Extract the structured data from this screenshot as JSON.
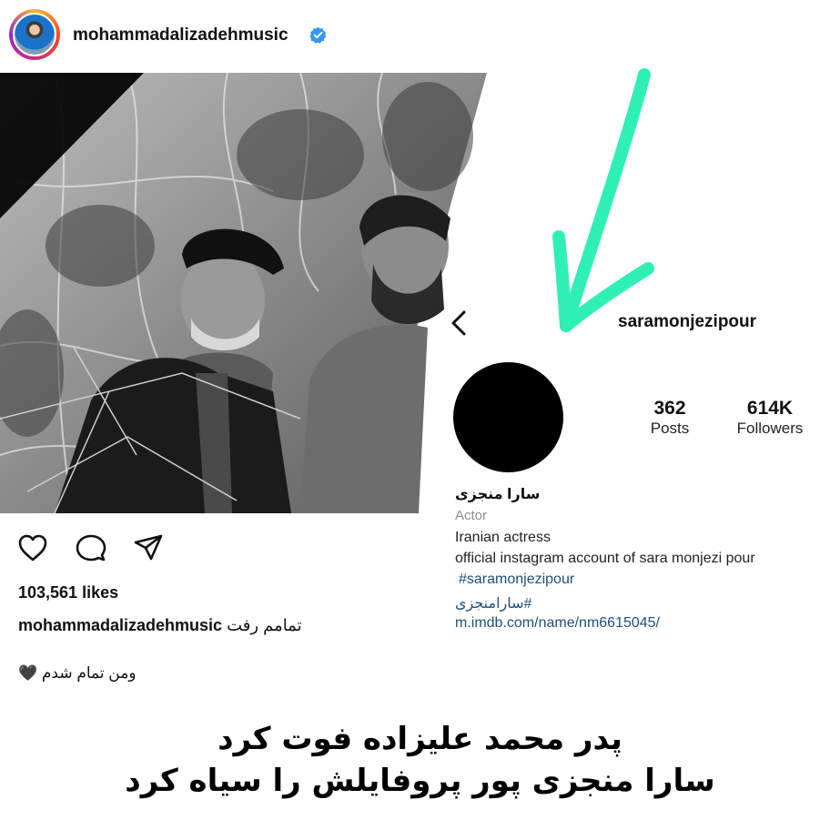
{
  "post": {
    "author_username": "mohammadalizadehmusic",
    "likes": "103,561 likes",
    "caption_text": "تمامم رفت",
    "comment_text": "ومن تمام شدم",
    "comment_emoji": "🖤"
  },
  "profile": {
    "username": "saramonjezipour",
    "stats": [
      {
        "value": "362",
        "label": "Posts"
      },
      {
        "value": "614K",
        "label": "Followers"
      }
    ],
    "display_name": "سارا منجزی",
    "category": "Actor",
    "bio_line1": "Iranian actress",
    "bio_line2": "official instagram account of sara monjezi pour",
    "hashtag_en": "#saramonjezipour",
    "hashtag_fa": "#سارامنجزی",
    "website": "m.imdb.com/name/nm6615045/"
  },
  "headline": {
    "line1": "پدر محمد علیزاده فوت کرد",
    "line2": "سارا منجزی پور پروفایلش را سیاه کرد"
  },
  "icons": {
    "verified": "verified-badge-icon",
    "like": "heart-icon",
    "comment": "comment-bubble-icon",
    "share": "send-paper-plane-icon",
    "back": "chevron-left-icon",
    "annotation": "green-arrow-icon"
  },
  "colors": {
    "verified_blue": "#3897f0",
    "arrow_green": "#2ef0b4",
    "link_blue": "#1f4e79"
  }
}
